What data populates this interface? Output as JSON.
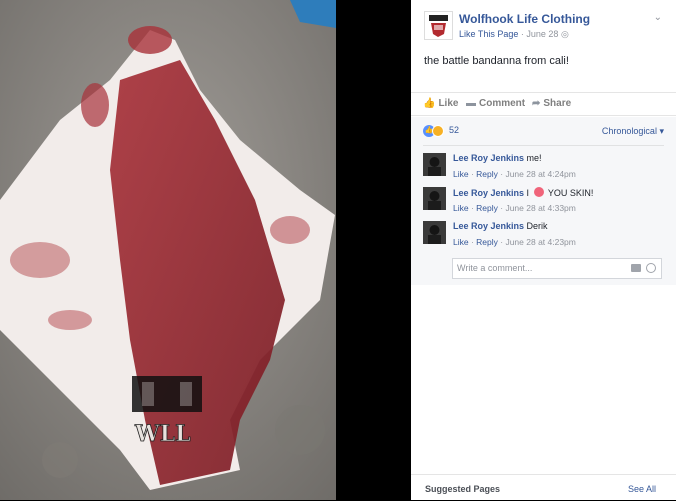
{
  "post": {
    "page_name": "Wolfhook Life Clothing",
    "like_page": "Like This Page",
    "date": "June 28",
    "text": "the battle bandanna from cali!",
    "photo_watermark": "WLL"
  },
  "actions": {
    "like": "Like",
    "comment": "Comment",
    "share": "Share"
  },
  "reactions": {
    "count": "52"
  },
  "sort": {
    "label": "Chronological",
    "caret": "▾"
  },
  "comments": [
    {
      "author": "Lee Roy Jenkins",
      "text": "me!",
      "text_before": "",
      "text_after": "",
      "like": "Like",
      "reply": "Reply",
      "timestamp": "June 28 at 4:24pm"
    },
    {
      "author": "Lee Roy Jenkins",
      "text": "",
      "text_before": "I",
      "text_after": "YOU SKIN!",
      "like": "Like",
      "reply": "Reply",
      "timestamp": "June 28 at 4:33pm"
    },
    {
      "author": "Lee Roy Jenkins",
      "text": "Derik",
      "text_before": "",
      "text_after": "",
      "like": "Like",
      "reply": "Reply",
      "timestamp": "June 28 at 4:23pm"
    }
  ],
  "write_comment": {
    "placeholder": "Write a comment..."
  },
  "suggested": {
    "title": "Suggested Pages",
    "see_all": "See All"
  }
}
